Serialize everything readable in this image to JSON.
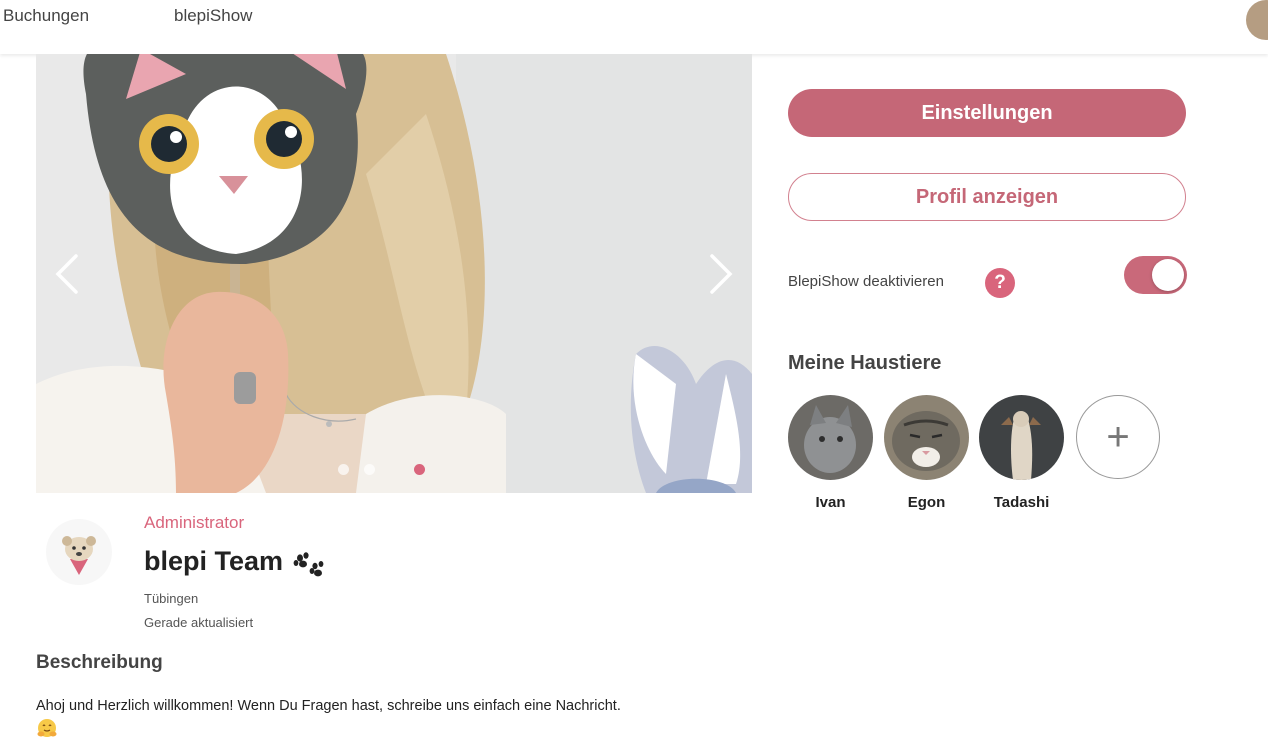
{
  "nav": {
    "items": [
      {
        "label": "Buchungen"
      },
      {
        "label": "blepiShow"
      }
    ]
  },
  "carousel": {
    "slide_count": 3,
    "active_slide": 3,
    "prev_icon": "chevron-left-icon",
    "next_icon": "chevron-right-icon"
  },
  "actions": {
    "settings_label": "Einstellungen",
    "profile_label": "Profil anzeigen"
  },
  "blepishow": {
    "deactivate_label": "BlepiShow deaktivieren",
    "help_glyph": "?",
    "toggle_on": true
  },
  "pets": {
    "title": "Meine Haustiere",
    "items": [
      {
        "name": "Ivan"
      },
      {
        "name": "Egon"
      },
      {
        "name": "Tadashi"
      }
    ],
    "add_glyph": "+"
  },
  "profile": {
    "role": "Administrator",
    "name": "blepi Team",
    "city": "Tübingen",
    "updated": "Gerade aktualisiert"
  },
  "description": {
    "title": "Beschreibung",
    "text": "Ahoj und Herzlich willkommen! Wenn Du Fragen hast, schreibe uns einfach eine Nachricht."
  },
  "colors": {
    "accent": "#c56777",
    "accent_light": "#d9657c"
  }
}
